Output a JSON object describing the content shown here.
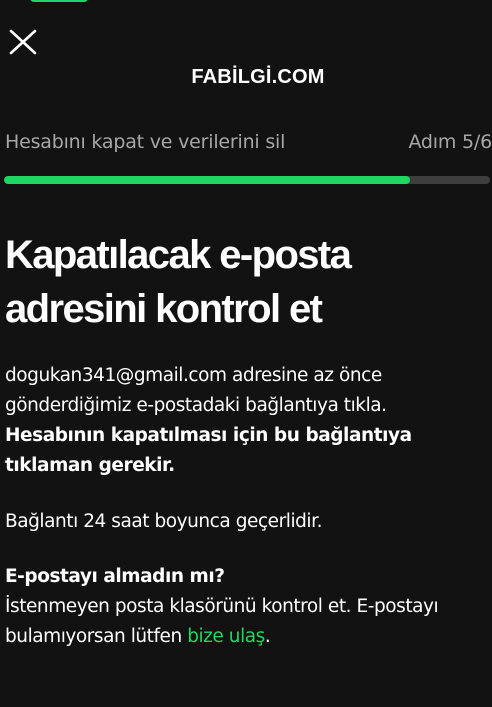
{
  "header": {
    "watermark": "FABİLGİ.COM"
  },
  "progress": {
    "title": "Hesabını kapat ve verilerini sil",
    "counter": "Adım 5/6",
    "fraction": 0.835,
    "color": "#1ed760",
    "track_color": "#3e3e3e"
  },
  "content": {
    "heading": "Kapatılacak e-posta adresini kontrol et",
    "intro": "dogukan341@gmail.com adresine az önce gönderdiğimiz e-postadaki bağlantıya tıkla.",
    "intro_bold": "Hesabının kapatılması için bu bağlantıya tıklaman gerekir.",
    "validity": "Bağlantı 24 saat boyunca geçerlidir.",
    "not_received_title": "E-postayı almadın mı?",
    "not_received_text": "İstenmeyen posta klasörünü kontrol et. E-postayı bulamıyorsan lütfen",
    "contact_link": "bize ulaş",
    "end_period": "."
  },
  "icons": {
    "close": "close-icon"
  }
}
